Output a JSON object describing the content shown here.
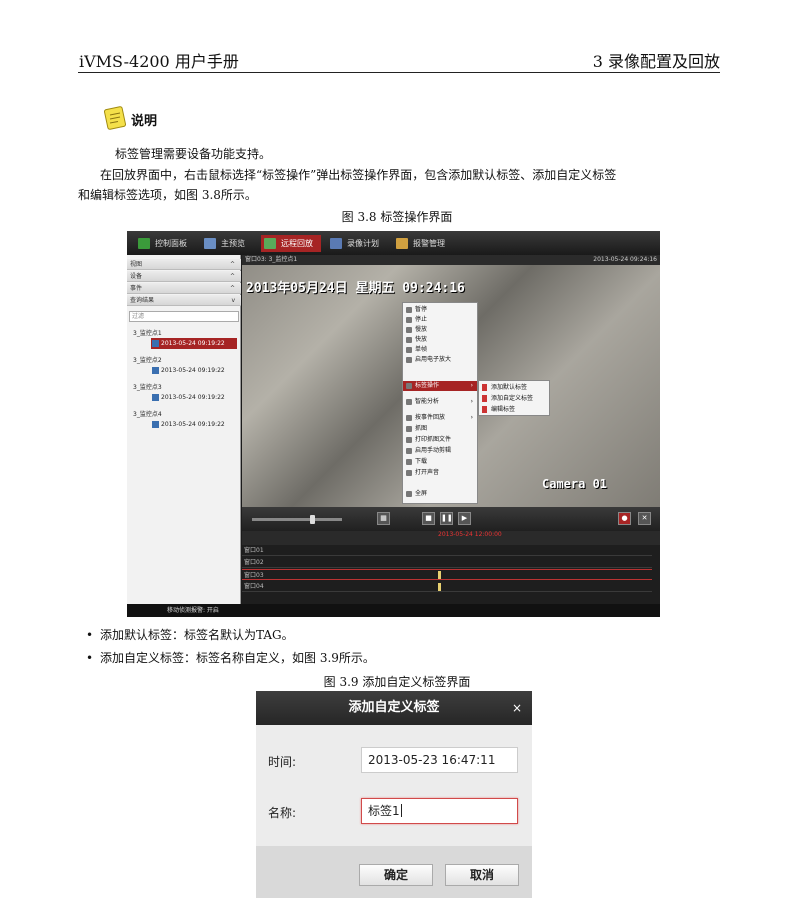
{
  "header": {
    "left": "iVMS-4200 用户手册",
    "right": "3 录像配置及回放"
  },
  "note": {
    "label": "说明",
    "text": "标签管理需要设备功能支持。"
  },
  "body": {
    "para1_line1": "在回放界面中，右击鼠标选择“标签操作”弹出标签操作界面，包含添加默认标签、添加自定义标签",
    "para1_line2": "和编辑标签选项，如图 3.8所示。",
    "figure1_caption": "图 3.8 标签操作界面",
    "bullets": [
      "添加默认标签：标签名默认为TAG。",
      "添加自定义标签：标签名称自定义，如图 3.9所示。"
    ],
    "figure2_caption": "图 3.9 添加自定义标签界面"
  },
  "app": {
    "tabs": [
      "控制面板",
      "主预览",
      "远程回放",
      "录像计划",
      "报警管理"
    ],
    "panel_rows": [
      "视图",
      "设备",
      "事件",
      "查询结果"
    ],
    "search_placeholder": "过滤",
    "cameras": [
      "3_监控点1",
      "3_监控点2",
      "3_监控点3",
      "3_监控点4"
    ],
    "clip_time": "2013-05-24 09:19:22",
    "video_title": "窗口03: 3_监控点1",
    "video_timestamp": "2013-05-24 09:24:16",
    "osd_text": "2013年05月24日 星期五 09:24:16",
    "osd_channel": "Camera 01",
    "context_menu": [
      "暂停",
      "停止",
      "慢放",
      "快放",
      "单帧",
      "启用电子放大",
      "标签操作",
      "智能分析",
      "按事件回放",
      "抓图",
      "打印抓图文件",
      "启用手动剪辑",
      "下载",
      "打开声音",
      "全屏"
    ],
    "sub_menu": [
      "添加默认标签",
      "添加自定义标签",
      "编辑标签"
    ],
    "timeline_now": "2013-05-24 12:00:00",
    "timeline_rows": [
      "窗口01",
      "窗口02",
      "窗口03",
      "窗口04"
    ],
    "status_text": "移动侦测报警: 开启"
  },
  "dialog": {
    "title": "添加自定义标签",
    "close": "×",
    "time_label": "时间:",
    "time_value": "2013-05-23 16:47:11",
    "name_label": "名称:",
    "name_value": "标签1",
    "ok": "确定",
    "cancel": "取消"
  },
  "colors": {
    "accent_red": "#a62424",
    "dialog_title_bg": "#2e2e2e"
  }
}
